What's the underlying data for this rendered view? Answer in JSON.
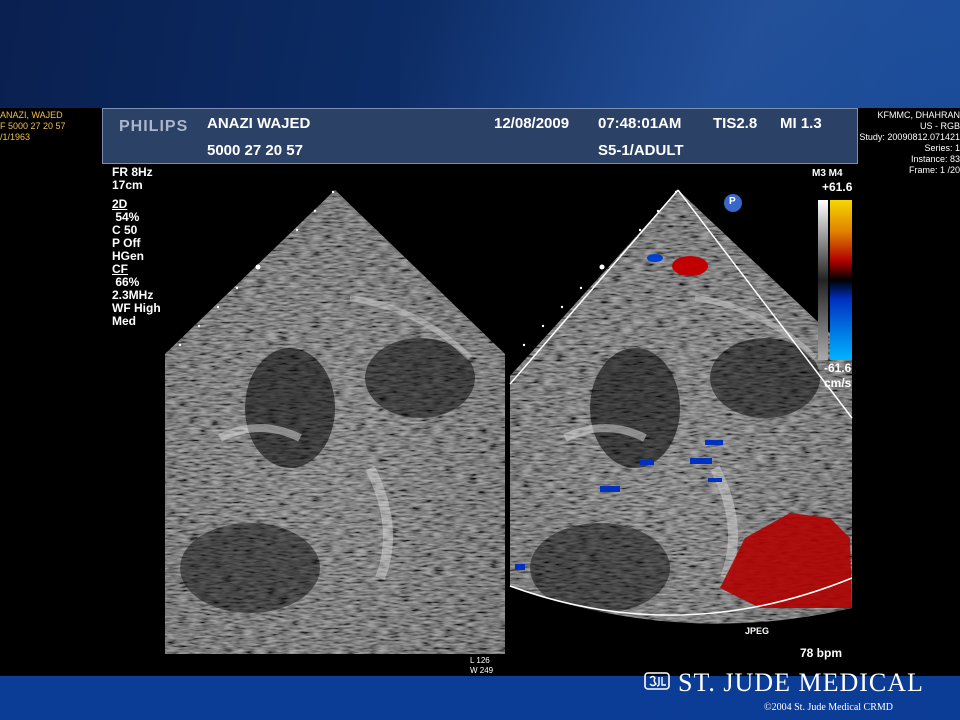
{
  "left_info": [
    "ANAZI, WAJED",
    "F 5000 27 20 57",
    "/1/1963"
  ],
  "right_info": [
    "KFMMC, DHAHRAN",
    "US - RGB",
    "Study: 20090812.071421",
    "Series: 1",
    "Instance: 83",
    "Frame: 1 /20"
  ],
  "banner": {
    "brand": "PHILIPS",
    "patient_name": "ANAZI WAJED",
    "patient_id": "5000 27 20 57",
    "date": "12/08/2009",
    "time": "07:48:01AM",
    "tis": "TIS2.8",
    "mi": "MI 1.3",
    "probe": "S5-1/ADULT"
  },
  "params": {
    "frame_rate": "FR 8Hz",
    "depth": "17cm",
    "mode_2d": "2D",
    "gain_2d": " 54%",
    "compression": "C 50",
    "persistence": "P Off",
    "harmonics": "HGen",
    "mode_cf": "CF",
    "gain_cf": " 66%",
    "frequency": "2.3MHz",
    "wall_filter": "WF High",
    "mode_med": "Med"
  },
  "color_scale": {
    "map": "M3 M4",
    "max": "+61.6",
    "min": "-61.6",
    "unit": "cm/s",
    "colors": {
      "top": "#f5d800",
      "upper": "#b00000",
      "lower": "#0030c0",
      "bottom": "#00b4ff"
    }
  },
  "markers": {
    "p_marker": "P",
    "jpeg": "JPEG",
    "heart_rate": "78 bpm",
    "level": "L 126",
    "window": "W 249"
  },
  "footer": {
    "company": "ST. JUDE MEDICAL",
    "copyright": "©2004 St. Jude Medical CRMD"
  }
}
